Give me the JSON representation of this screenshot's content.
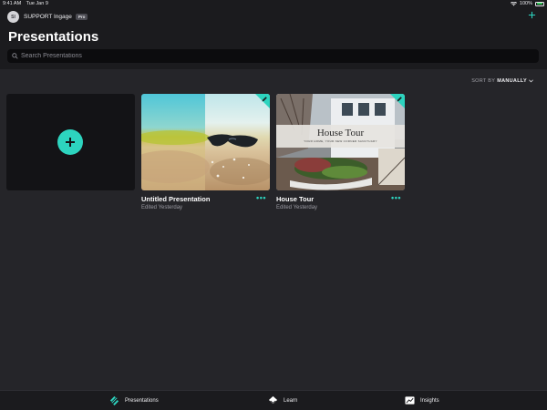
{
  "status_bar": {
    "time": "9:41 AM",
    "date": "Tue Jan 9",
    "battery": "100%",
    "battery_color": "#34c759"
  },
  "header": {
    "avatar_initials": "SI",
    "account_name": "SUPPORT Ingage",
    "plan_badge": "Pro",
    "add_icon": "plus-icon",
    "title": "Presentations"
  },
  "search": {
    "placeholder": "Search Presentations",
    "value": ""
  },
  "sort": {
    "prefix": "SORT BY",
    "value": "MANUALLY"
  },
  "new_presentation": {
    "icon": "plus-icon"
  },
  "presentations": [
    {
      "title": "Untitled Presentation",
      "edited": "Edited Yesterday",
      "thumbnail": "beach-sunglasses-photo"
    },
    {
      "title": "House Tour",
      "edited": "Edited Yesterday",
      "thumbnail": "white-house-photo",
      "slide_title": "House Tour",
      "slide_subtitle": "YOUR HOME, YOUR NEW CORNER SANCTUARY"
    }
  ],
  "tabs": [
    {
      "label": "Presentations",
      "icon": "presentations-icon"
    },
    {
      "label": "Learn",
      "icon": "learn-icon"
    },
    {
      "label": "Insights",
      "icon": "insights-icon"
    }
  ],
  "colors": {
    "accent": "#2dd4bf",
    "background": "#252529",
    "header": "#1b1b1e",
    "search_field": "#0c0c0e"
  }
}
